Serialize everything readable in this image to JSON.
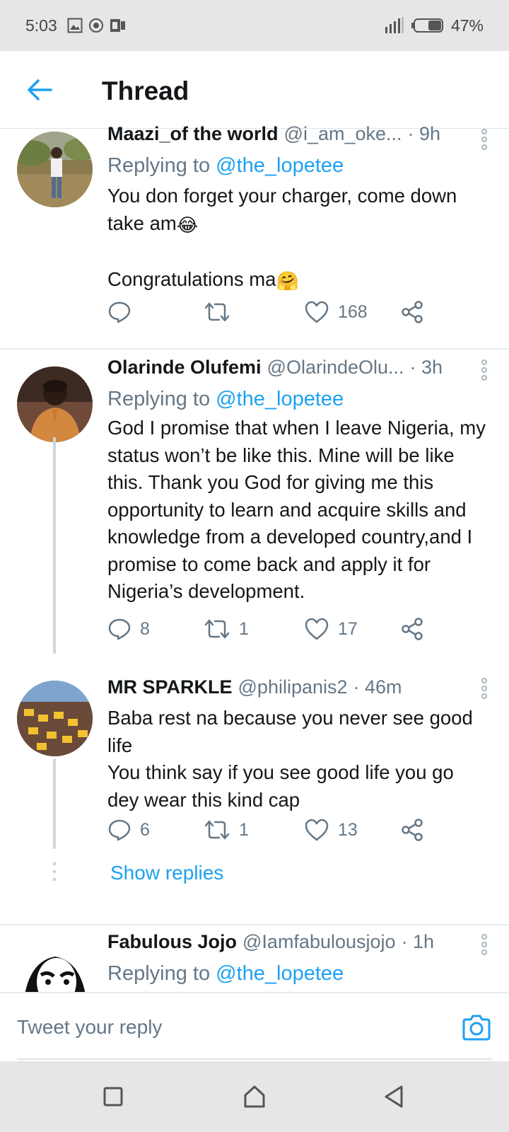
{
  "status_bar": {
    "time": "5:03",
    "battery": "47%"
  },
  "header": {
    "title": "Thread"
  },
  "tweets": [
    {
      "name": "Maazi_of the world",
      "handle": "@i_am_oke...",
      "time": "· 9h",
      "replying_label": "Replying to",
      "replying_to": "@the_lopetee",
      "text_line1": "You don forget your charger, come down take am",
      "emoji1": "😂",
      "text_line2": "Congratulations ma",
      "emoji2": "🤗",
      "replies": "",
      "retweets": "",
      "likes": "168"
    },
    {
      "name": "Olarinde Olufemi",
      "handle": "@OlarindeOlu...",
      "time": "· 3h",
      "replying_label": "Replying to",
      "replying_to": "@the_lopetee",
      "text": "God I promise that when I leave Nigeria, my status won’t be like this. Mine will be like this. Thank you God for giving me this opportunity to learn and acquire skills and knowledge from a developed country,and I promise to come back and apply it for Nigeria’s development.",
      "replies": "8",
      "retweets": "1",
      "likes": "17"
    },
    {
      "name": "MR SPARKLE",
      "handle": "@philipanis2",
      "time": "· 46m",
      "text_line1": "Baba rest na because you never see good life",
      "text_line2": "You think say if you see good life you go dey wear this kind cap",
      "replies": "6",
      "retweets": "1",
      "likes": "13",
      "show_replies": "Show replies"
    },
    {
      "name": "Fabulous Jojo",
      "handle": "@Iamfabulousjojo",
      "time": "· 1h",
      "replying_label": "Replying to",
      "replying_to": "@the_lopetee"
    }
  ],
  "reply_bar": {
    "placeholder": "Tweet your reply"
  },
  "icons": {
    "back": "arrow-left-icon",
    "reply": "comment-icon",
    "retweet": "retweet-icon",
    "like": "heart-icon",
    "share": "share-icon",
    "more": "more-vertical-icon",
    "camera": "camera-icon"
  },
  "colors": {
    "accent": "#1da1f2",
    "secondary_text": "#657786",
    "primary_text": "#14171a"
  }
}
